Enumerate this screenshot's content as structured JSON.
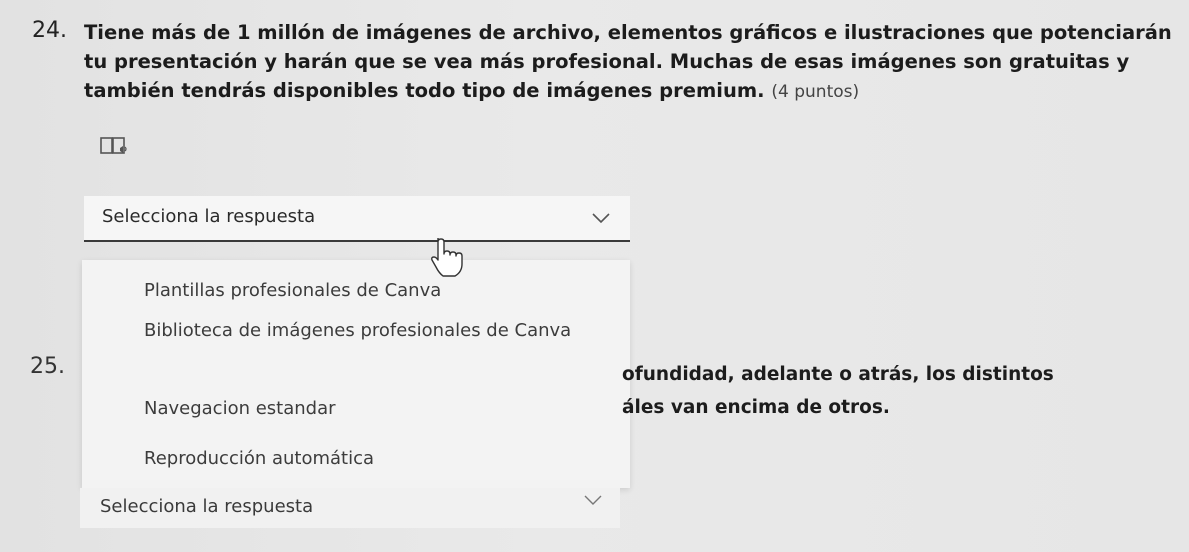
{
  "question24": {
    "number": "24.",
    "text": "Tiene más de 1 millón de imágenes de archivo, elementos gráficos e ilustraciones que potenciarán tu presentación y harán que se vea más profesional. Muchas de esas imágenes son gratuitas y también tendrás disponibles todo tipo de imágenes premium.",
    "points": "(4 puntos)",
    "reader_icon": "immersive-reader-icon",
    "select": {
      "label": "Selecciona la respuesta",
      "icon": "chevron-down-icon"
    },
    "options": [
      "Plantillas profesionales de Canva",
      "Biblioteca de imágenes profesionales de Canva",
      "Navegacion estandar",
      "Reproducción automática"
    ]
  },
  "question25": {
    "number": "25.",
    "text_line1": "ofundidad, adelante o atrás, los distintos",
    "text_line2": "áles van encima de otros.",
    "select": {
      "label": "Selecciona la respuesta",
      "icon": "chevron-down-icon"
    }
  },
  "cursor_icon": "hand-pointer-icon"
}
